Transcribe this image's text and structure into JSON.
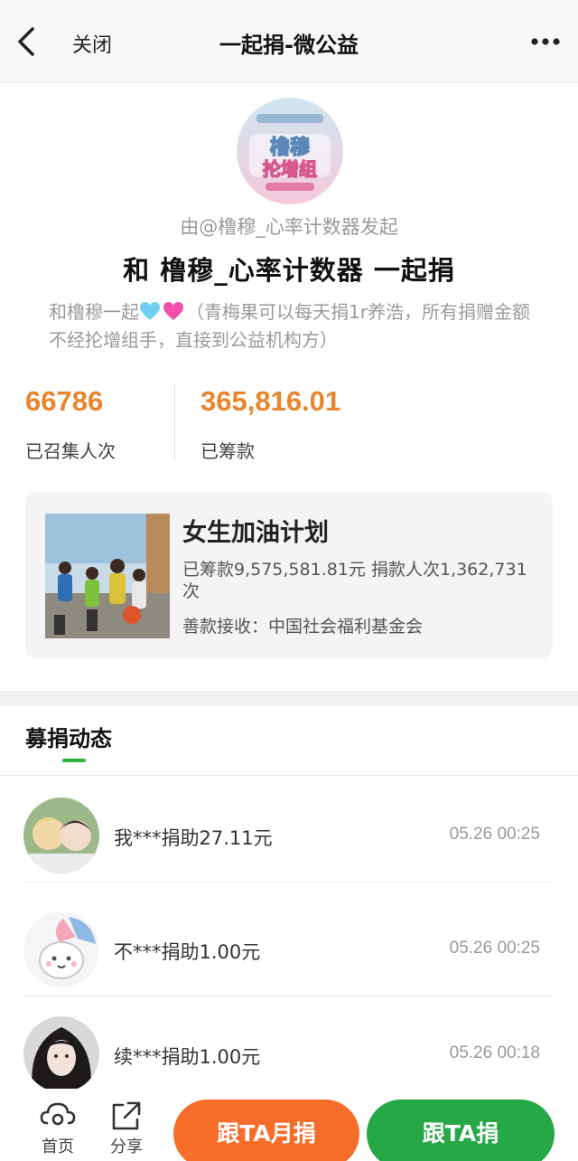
{
  "nav": {
    "close_label": "关闭",
    "title": "一起捐-微公益"
  },
  "campaign": {
    "avatar_text": [
      "橹穆",
      "抡增组"
    ],
    "initiator": "由@橹穆_心率计数器发起",
    "headline": "和 橹穆_心率计数器 一起捐",
    "desc_prefix": "和橹穆一起",
    "desc_rest": "（青梅果可以每天捐1r养浩，所有捐赠金额不经抡增组手，直接到公益机构方）",
    "heart_colors": [
      "#6fd0f2",
      "#f24fa8"
    ]
  },
  "stats": {
    "people_count": "66786",
    "people_label": "已召集人次",
    "amount": "365,816.01",
    "amount_label": "已筹款"
  },
  "project": {
    "title": "女生加油计划",
    "stats": "已筹款9,575,581.81元  捐款人次1,362,731次",
    "receiver": "善款接收：中国社会福利基金会"
  },
  "feed": {
    "section_title": "募捐动态",
    "items": [
      {
        "text": "我***捐助27.11元",
        "time": "05.26 00:25"
      },
      {
        "text": "不***捐助1.00元",
        "time": "05.26 00:25"
      },
      {
        "text": "续***捐助1.00元",
        "time": "05.26 00:18"
      }
    ]
  },
  "bottom": {
    "home_label": "首页",
    "share_label": "分享",
    "monthly_label": "跟TA月捐",
    "donate_label": "跟TA捐"
  },
  "colors": {
    "accent_orange": "#e8852d",
    "monthly_button": "#f76d2a",
    "donate_button": "#26a846",
    "tab_underline": "#2bb53e"
  }
}
